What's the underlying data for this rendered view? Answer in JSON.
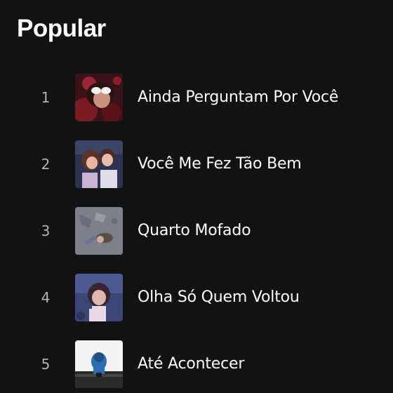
{
  "section": {
    "title": "Popular"
  },
  "tracks": [
    {
      "index": "1",
      "title": "Ainda Perguntam Por Você",
      "cover_icon": "album-cover-icon"
    },
    {
      "index": "2",
      "title": "Você Me Fez Tão Bem",
      "cover_icon": "album-cover-icon"
    },
    {
      "index": "3",
      "title": "Quarto Mofado",
      "cover_icon": "album-cover-icon"
    },
    {
      "index": "4",
      "title": "Olha Só Quem Voltou",
      "cover_icon": "album-cover-icon"
    },
    {
      "index": "5",
      "title": "Até Acontecer",
      "cover_icon": "album-cover-icon"
    }
  ],
  "colors": {
    "background": "#121212",
    "text_primary": "#ffffff",
    "text_secondary": "#b3b3b3"
  }
}
